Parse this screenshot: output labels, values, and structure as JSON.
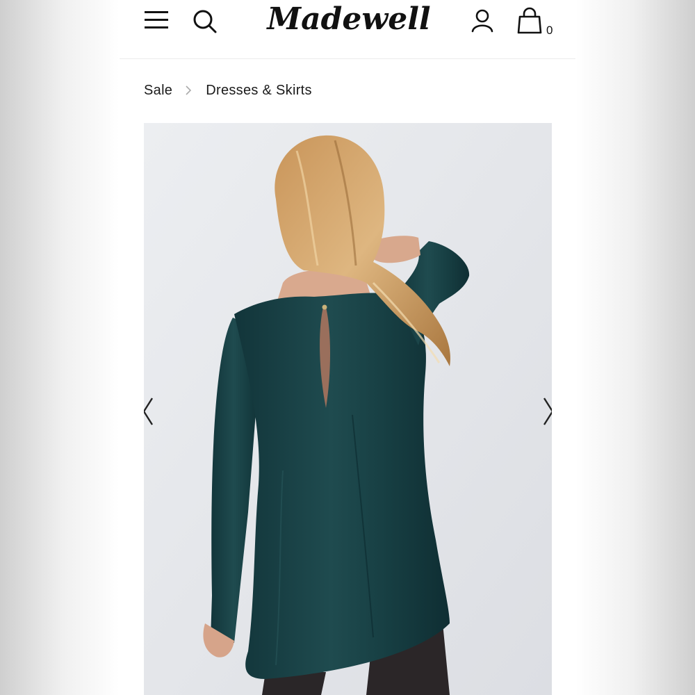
{
  "header": {
    "brand": "Madewell",
    "bag_count": "0"
  },
  "breadcrumb": {
    "items": [
      {
        "label": "Sale"
      },
      {
        "label": "Dresses & Skirts"
      }
    ]
  },
  "gallery": {
    "image": "product-photo-back-view",
    "prev_icon": "chevron-left-icon",
    "next_icon": "chevron-right-icon"
  },
  "colors": {
    "text": "#111111",
    "dress": "#183f42",
    "background": "#e7e8ec"
  }
}
